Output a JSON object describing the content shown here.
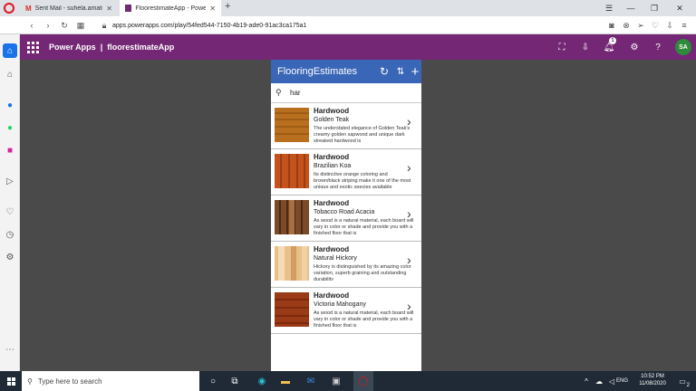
{
  "browser": {
    "tabs": [
      {
        "label": "Sent Mail - suhela.amatull@...",
        "icon": "gmail-icon",
        "icon_color": "#d93025"
      },
      {
        "label": "FloorestimateApp - Power A...",
        "icon": "powerapps-icon",
        "icon_color": "#742774"
      }
    ],
    "new_tab": "+",
    "url": "apps.powerapps.com/play/54fed544-7150-4b19-ade0-91ac3ca175a1"
  },
  "header": {
    "brand": "Power Apps",
    "separator": "|",
    "app_name": "floorestimateApp",
    "notification_count": "1",
    "avatar_initials": "SA",
    "bg_color": "#742774"
  },
  "app": {
    "title": "FlooringEstimates",
    "bar_color": "#3a66b7",
    "search_value": "har",
    "items": [
      {
        "category": "Hardwood",
        "name": "Golden Teak",
        "description": "The understated elegance of Golden Teak's creamy golden sapwood and unique dark streaked hardwood is"
      },
      {
        "category": "Hardwood",
        "name": "Brazilian Koa",
        "description": "Its distinctive orange coloring and brown/black striping make it one of the most unique and exotic species available"
      },
      {
        "category": "Hardwood",
        "name": "Tobacco Road Acacia",
        "description": "As wood is a natural material, each board will vary in color or shade and provide you with a finished floor that is"
      },
      {
        "category": "Hardwood",
        "name": "Natural Hickory",
        "description": "Hickory is distinguished by its amazing color variation, superb graining and outstanding durability"
      },
      {
        "category": "Hardwood",
        "name": "Victoria Mahogany",
        "description": "As wood is a natural material, each board will vary in color or shade and provide you with a finished floor that is"
      }
    ]
  },
  "taskbar": {
    "search_placeholder": "Type here to search",
    "language": "ENG",
    "time": "10:52 PM",
    "date": "11/08/2020",
    "notif_count": "2"
  }
}
